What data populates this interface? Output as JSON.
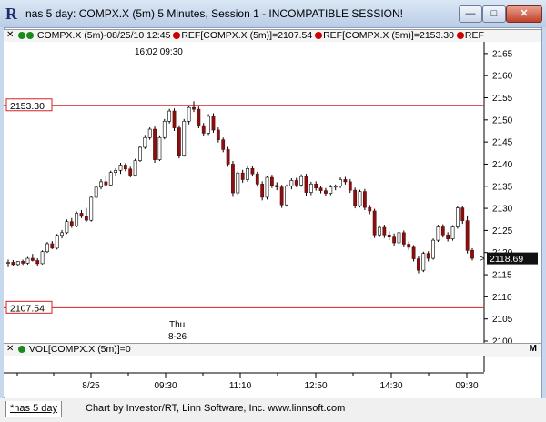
{
  "window": {
    "app_icon": "R",
    "title": "nas 5 day: COMPX.X (5m) 5 Minutes, Session 1 - INCOMPATIBLE SESSION!",
    "min_glyph": "—",
    "max_glyph": "□",
    "close_glyph": "✕"
  },
  "legend": {
    "close_glyph": "✕",
    "symbol": "COMPX.X (5m)-08/25/10 12:45",
    "ref1": "REF[COMPX.X (5m)]=2107.54",
    "ref2": "REF[COMPX.X (5m)]=2153.30",
    "ref3": "REF",
    "m_label": "M",
    "colors": {
      "dot1": "#1a8a1a",
      "dot2": "#cc0000"
    }
  },
  "volume_legend": {
    "close_glyph": "✕",
    "label": "VOL[COMPX.X (5m)]=0",
    "m_label": "M",
    "dot_color": "#1a8a1a"
  },
  "chart_annotations": {
    "header_time": "16:02  09:30",
    "day_label_1": "Thu",
    "day_label_2": "8-26",
    "ref_high_label": "2153.30",
    "ref_low_label": "2107.54",
    "last_price": "2118.69",
    "ref_color": "#d62020",
    "last_price_color": "#1a8a1a"
  },
  "status": {
    "tab_label": "*nas 5 day",
    "credits": "Chart by Investor/RT, Linn Software, Inc. www.linnsoft.com"
  },
  "chart_data": {
    "type": "candlestick",
    "symbol": "COMPX.X",
    "interval": "5 Minutes",
    "y_axis": {
      "range": [
        2100,
        2166
      ],
      "ticks": [
        2165,
        2160,
        2155,
        2150,
        2145,
        2140,
        2135,
        2130,
        2125,
        2120,
        2115,
        2110,
        2105,
        2100
      ]
    },
    "x_axis": {
      "ticks": [
        "8/25",
        "09:30",
        "11:10",
        "12:50",
        "14:30",
        "09:30"
      ]
    },
    "reference_lines": [
      2153.3,
      2107.54
    ],
    "last": 2118.69,
    "candles": [
      [
        2117.6,
        2118.4,
        2116.7,
        2117.8
      ],
      [
        2117.8,
        2118.3,
        2117.0,
        2117.3
      ],
      [
        2117.3,
        2118.1,
        2116.9,
        2118.0
      ],
      [
        2118.0,
        2118.4,
        2117.2,
        2117.6
      ],
      [
        2117.6,
        2119.0,
        2117.3,
        2118.7
      ],
      [
        2118.7,
        2119.7,
        2118.0,
        2118.2
      ],
      [
        2118.2,
        2118.7,
        2116.9,
        2117.5
      ],
      [
        2117.5,
        2120.5,
        2117.3,
        2120.2
      ],
      [
        2120.2,
        2122.4,
        2119.9,
        2122.0
      ],
      [
        2122.0,
        2122.6,
        2120.8,
        2121.0
      ],
      [
        2121.0,
        2124.2,
        2120.7,
        2123.9
      ],
      [
        2123.9,
        2125.1,
        2123.2,
        2124.5
      ],
      [
        2124.5,
        2127.5,
        2124.2,
        2127.0
      ],
      [
        2127.0,
        2127.8,
        2125.6,
        2126.0
      ],
      [
        2126.0,
        2129.3,
        2125.7,
        2128.9
      ],
      [
        2128.9,
        2129.6,
        2127.8,
        2128.2
      ],
      [
        2128.2,
        2130.1,
        2126.9,
        2127.3
      ],
      [
        2127.3,
        2132.9,
        2127.0,
        2132.5
      ],
      [
        2132.5,
        2135.2,
        2132.1,
        2134.8
      ],
      [
        2134.8,
        2136.6,
        2134.3,
        2136.0
      ],
      [
        2136.0,
        2137.4,
        2134.9,
        2135.3
      ],
      [
        2135.3,
        2138.5,
        2135.0,
        2138.1
      ],
      [
        2138.1,
        2139.1,
        2137.4,
        2138.6
      ],
      [
        2138.6,
        2140.3,
        2137.8,
        2139.8
      ],
      [
        2139.8,
        2140.2,
        2138.4,
        2138.9
      ],
      [
        2138.9,
        2139.4,
        2137.0,
        2137.5
      ],
      [
        2137.5,
        2141.2,
        2137.2,
        2140.8
      ],
      [
        2140.8,
        2144.2,
        2140.5,
        2143.8
      ],
      [
        2143.8,
        2146.6,
        2143.4,
        2146.0
      ],
      [
        2146.0,
        2148.3,
        2145.5,
        2147.9
      ],
      [
        2147.9,
        2148.5,
        2140.3,
        2141.0
      ],
      [
        2141.0,
        2146.5,
        2140.7,
        2146.0
      ],
      [
        2146.0,
        2150.2,
        2145.6,
        2149.7
      ],
      [
        2149.7,
        2152.5,
        2149.2,
        2152.0
      ],
      [
        2152.0,
        2152.6,
        2147.5,
        2148.2
      ],
      [
        2148.2,
        2148.8,
        2141.3,
        2142.0
      ],
      [
        2142.0,
        2150.2,
        2141.7,
        2149.7
      ],
      [
        2149.7,
        2153.2,
        2149.0,
        2152.8
      ],
      [
        2152.8,
        2154.2,
        2151.8,
        2152.4
      ],
      [
        2152.4,
        2153.0,
        2148.1,
        2148.7
      ],
      [
        2148.7,
        2149.3,
        2146.4,
        2147.0
      ],
      [
        2147.0,
        2151.3,
        2146.6,
        2150.8
      ],
      [
        2150.8,
        2151.5,
        2147.1,
        2147.7
      ],
      [
        2147.7,
        2148.3,
        2144.9,
        2145.5
      ],
      [
        2145.5,
        2146.0,
        2142.7,
        2143.3
      ],
      [
        2143.3,
        2143.9,
        2139.4,
        2140.0
      ],
      [
        2140.0,
        2140.7,
        2132.6,
        2133.5
      ],
      [
        2133.5,
        2138.4,
        2133.0,
        2138.0
      ],
      [
        2138.0,
        2138.7,
        2135.8,
        2136.5
      ],
      [
        2136.5,
        2139.5,
        2136.0,
        2139.0
      ],
      [
        2139.0,
        2139.5,
        2137.2,
        2137.8
      ],
      [
        2137.8,
        2138.3,
        2134.9,
        2135.5
      ],
      [
        2135.5,
        2136.1,
        2131.8,
        2132.5
      ],
      [
        2132.5,
        2137.4,
        2132.0,
        2137.0
      ],
      [
        2137.0,
        2137.6,
        2134.6,
        2135.2
      ],
      [
        2135.2,
        2135.9,
        2134.1,
        2134.8
      ],
      [
        2134.8,
        2135.3,
        2130.1,
        2130.8
      ],
      [
        2130.8,
        2135.4,
        2130.4,
        2135.0
      ],
      [
        2135.0,
        2136.8,
        2134.3,
        2136.3
      ],
      [
        2136.3,
        2136.9,
        2134.8,
        2135.3
      ],
      [
        2135.3,
        2137.7,
        2134.9,
        2137.2
      ],
      [
        2137.2,
        2137.8,
        2132.9,
        2133.6
      ],
      [
        2133.6,
        2136.0,
        2133.0,
        2135.5
      ],
      [
        2135.5,
        2136.1,
        2134.0,
        2134.6
      ],
      [
        2134.6,
        2135.1,
        2133.4,
        2134.0
      ],
      [
        2134.0,
        2134.6,
        2132.9,
        2133.4
      ],
      [
        2133.4,
        2135.3,
        2133.0,
        2134.8
      ],
      [
        2134.8,
        2135.4,
        2134.1,
        2135.0
      ],
      [
        2135.0,
        2137.0,
        2134.6,
        2136.5
      ],
      [
        2136.5,
        2137.1,
        2135.4,
        2136.0
      ],
      [
        2136.0,
        2136.6,
        2133.5,
        2134.1
      ],
      [
        2134.1,
        2134.7,
        2130.0,
        2130.6
      ],
      [
        2130.6,
        2134.2,
        2130.2,
        2133.8
      ],
      [
        2133.8,
        2134.4,
        2129.6,
        2130.2
      ],
      [
        2130.2,
        2130.8,
        2128.7,
        2129.4
      ],
      [
        2129.4,
        2129.9,
        2123.3,
        2124.0
      ],
      [
        2124.0,
        2126.2,
        2123.5,
        2125.7
      ],
      [
        2125.7,
        2126.3,
        2123.3,
        2124.0
      ],
      [
        2124.0,
        2124.8,
        2122.8,
        2123.5
      ],
      [
        2123.5,
        2124.3,
        2121.6,
        2122.2
      ],
      [
        2122.2,
        2124.9,
        2121.9,
        2124.5
      ],
      [
        2124.5,
        2125.0,
        2121.2,
        2121.9
      ],
      [
        2121.9,
        2122.5,
        2120.6,
        2121.2
      ],
      [
        2121.2,
        2121.7,
        2118.0,
        2118.6
      ],
      [
        2118.6,
        2119.2,
        2115.3,
        2116.0
      ],
      [
        2116.0,
        2120.2,
        2115.6,
        2119.8
      ],
      [
        2119.8,
        2120.3,
        2118.0,
        2118.7
      ],
      [
        2118.7,
        2123.2,
        2118.4,
        2122.8
      ],
      [
        2122.8,
        2126.3,
        2122.4,
        2125.8
      ],
      [
        2125.8,
        2126.4,
        2123.4,
        2124.0
      ],
      [
        2124.0,
        2124.6,
        2122.5,
        2123.1
      ],
      [
        2123.1,
        2126.2,
        2122.7,
        2125.8
      ],
      [
        2125.8,
        2130.6,
        2125.4,
        2130.1
      ],
      [
        2130.1,
        2130.5,
        2126.5,
        2127.2
      ],
      [
        2127.2,
        2128.4,
        2119.8,
        2120.5
      ],
      [
        2120.5,
        2121.0,
        2118.2,
        2118.7
      ]
    ]
  }
}
